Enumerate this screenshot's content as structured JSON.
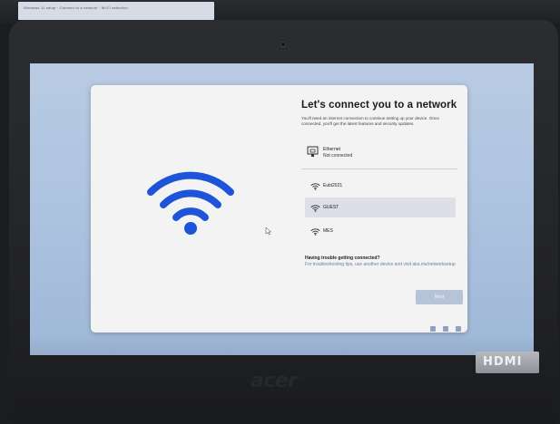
{
  "background": {
    "monitor_text": "Windows 11 setup  ·  Connect to a network  ·  Wi-Fi selection"
  },
  "oobe": {
    "title": "Let's connect you to a network",
    "subtitle": "You'll need an internet connection to continue setting up your device. Once connected, you'll get the latest features and security updates.",
    "ethernet": {
      "name": "Ethernet",
      "status": "Not connected"
    },
    "networks": [
      {
        "name": "Eubi2021",
        "selected": false
      },
      {
        "name": "GUEST",
        "selected": true
      },
      {
        "name": "MES",
        "selected": false
      }
    ],
    "trouble": {
      "title": "Having trouble getting connected?",
      "text": "For troubleshooting tips, use another device and visit aka.ms/networksetup"
    },
    "next_label": "Next"
  },
  "hardware": {
    "brand": "acer",
    "sticker": "HDMI"
  },
  "colors": {
    "accent_wifi": "#1e54d8",
    "screen_bg": "#b9cbe3",
    "card_bg": "#f3f3f3",
    "selected_row": "#dcdee8",
    "next_button": "#b7c3d8"
  }
}
